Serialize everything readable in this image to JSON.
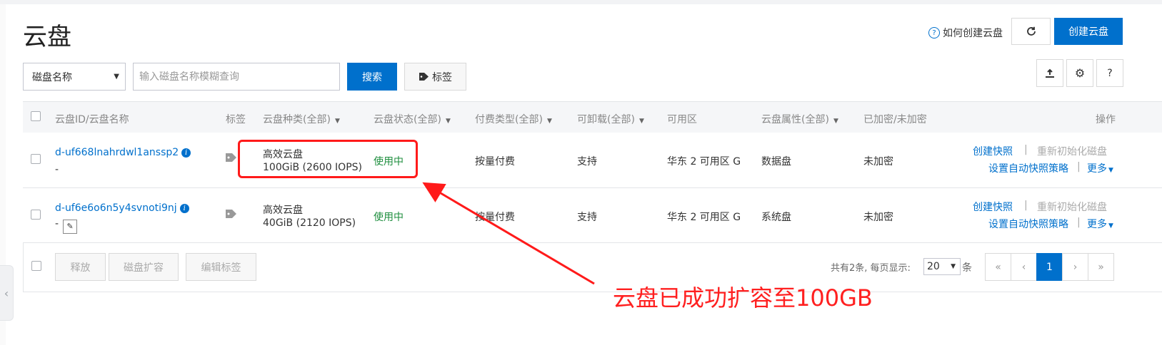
{
  "header": {
    "title": "云盘",
    "howto_label": "如何创建云盘",
    "create_label": "创建云盘"
  },
  "toolbar": {
    "filter_select": "磁盘名称",
    "search_placeholder": "输入磁盘名称模糊查询",
    "search_button": "搜索",
    "tag_button": "标签"
  },
  "table": {
    "columns": {
      "id_name": "云盘ID/云盘名称",
      "tag": "标签",
      "type": "云盘种类(全部)",
      "status": "云盘状态(全部)",
      "billing": "付费类型(全部)",
      "detachable": "可卸载(全部)",
      "zone": "可用区",
      "attribute": "云盘属性(全部)",
      "encrypted": "已加密/未加密",
      "actions": "操作"
    },
    "rows": [
      {
        "id": "d-uf668lnahrdwl1anssp2",
        "name": "-",
        "type": "高效云盘",
        "size": "100GiB (2600 IOPS)",
        "status": "使用中",
        "billing": "按量付费",
        "detachable": "支持",
        "zone": "华东 2 可用区 G",
        "attribute": "数据盘",
        "encrypted": "未加密",
        "action_snapshot": "创建快照",
        "action_reinit": "重新初始化磁盘",
        "action_policy": "设置自动快照策略",
        "action_more": "更多"
      },
      {
        "id": "d-uf6e6o6n5y4svnoti9nj",
        "name": "-",
        "type": "高效云盘",
        "size": "40GiB (2120 IOPS)",
        "status": "使用中",
        "billing": "按量付费",
        "detachable": "支持",
        "zone": "华东 2 可用区 G",
        "attribute": "系统盘",
        "encrypted": "未加密",
        "action_snapshot": "创建快照",
        "action_reinit": "重新初始化磁盘",
        "action_policy": "设置自动快照策略",
        "action_more": "更多"
      }
    ],
    "action_separator": "|"
  },
  "footer": {
    "release": "释放",
    "expand": "磁盘扩容",
    "edit_tags": "编辑标签",
    "total_text": "共有2条, 每页显示:",
    "page_size": "20",
    "page_unit": "条",
    "pager": {
      "first": "«",
      "prev": "‹",
      "current": "1",
      "next": "›",
      "last": "»"
    }
  },
  "annotation": {
    "text": "云盘已成功扩容至100GB",
    "color": "#ff2020"
  },
  "colors": {
    "primary": "#0070cc",
    "success": "#1e8e3e",
    "annotation": "#ff1a1a"
  }
}
